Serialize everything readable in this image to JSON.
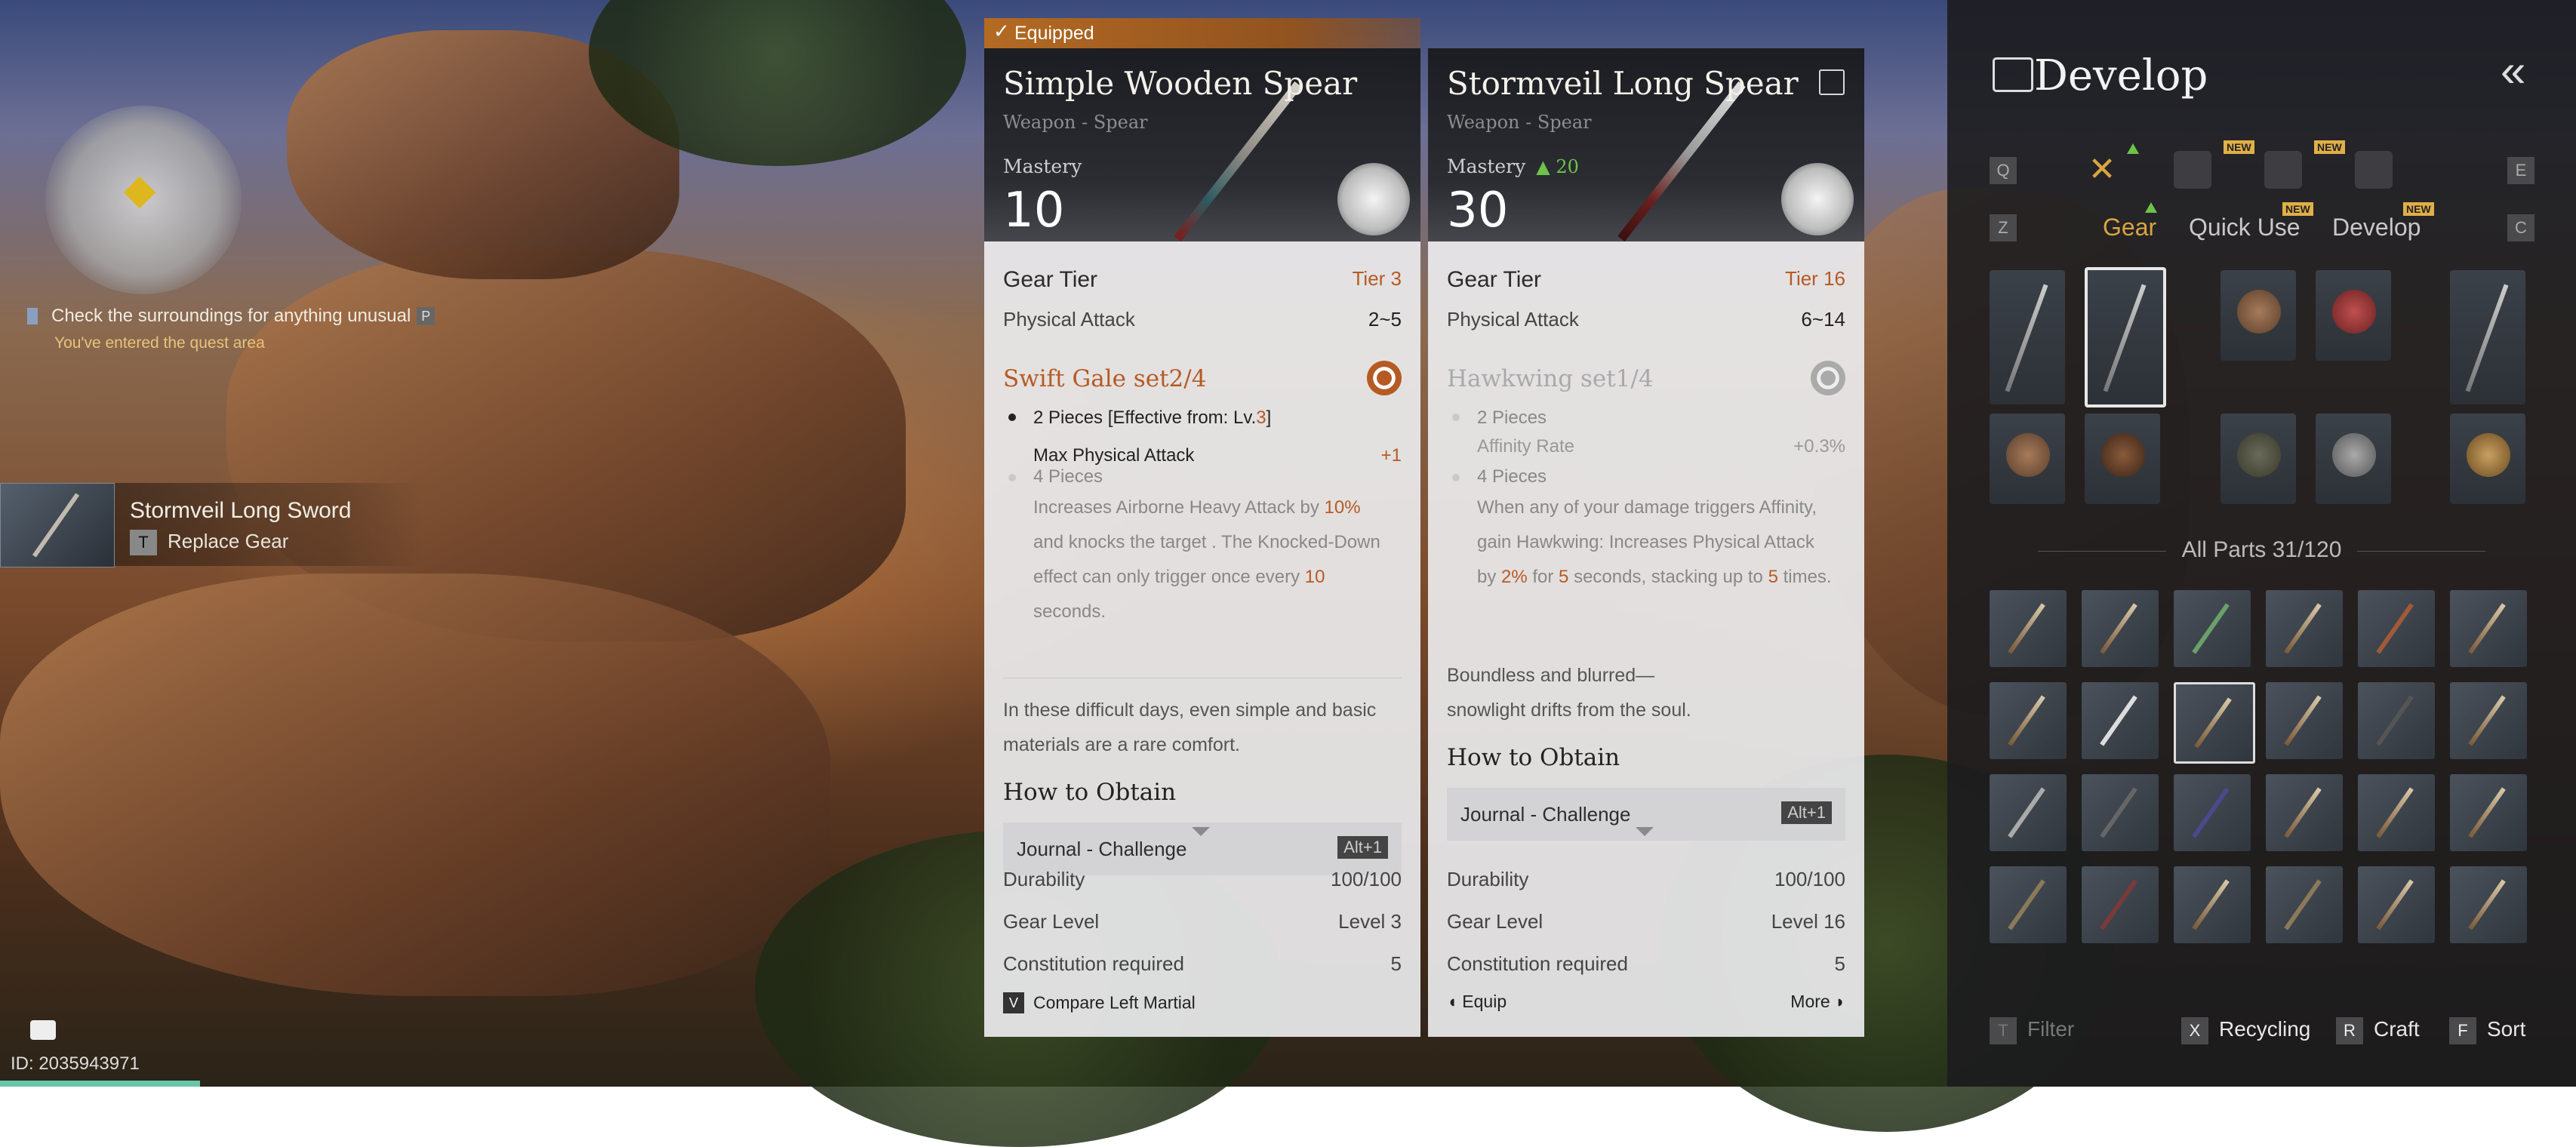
{
  "hud": {
    "quest_text": "Check the surroundings for anything unusual",
    "quest_key": "P",
    "quest_sub": "You've entered the quest area",
    "pickup_name": "Stormveil Long Sword",
    "pickup_key": "T",
    "pickup_action": "Replace Gear",
    "id_text": "ID: 2035943971"
  },
  "equipped_label": "Equipped",
  "left_card": {
    "name": "Simple Wooden Spear",
    "type": "Weapon - Spear",
    "mastery_label": "Mastery",
    "mastery": "10",
    "gear_tier_label": "Gear Tier",
    "gear_tier": "Tier 3",
    "phys_label": "Physical Attack",
    "phys": "2~5",
    "set_name": "Swift Gale set2/4",
    "piece2_label": "2 Pieces [Effective from: Lv.",
    "piece2_lv": "3",
    "piece2_close": "]",
    "piece2_stat": "Max Physical Attack",
    "piece2_val": "+1",
    "piece4_label": "4 Pieces",
    "piece4_text_a": "Increases Airborne Heavy Attack by ",
    "piece4_pct": "10%",
    "piece4_text_b": "and knocks the target . The Knocked-Down",
    "piece4_text_c": "effect can only trigger once every ",
    "piece4_num": "10",
    "piece4_text_d": "seconds.",
    "flavor_1": "In these difficult days, even simple and basic",
    "flavor_2": "materials are a rare comfort.",
    "obtain_title": "How to Obtain",
    "source": "Journal - Challenge",
    "source_key": "Alt+1",
    "durability_label": "Durability",
    "durability": "100/100",
    "gear_level_label": "Gear Level",
    "gear_level": "Level 3",
    "constitution_label": "Constitution required",
    "constitution": "5",
    "footer_key": "V",
    "footer_text": "Compare Left Martial"
  },
  "right_card": {
    "name": "Stormveil Long Spear",
    "type": "Weapon - Spear",
    "mastery_label": "Mastery",
    "mastery_delta": "20",
    "mastery": "30",
    "gear_tier_label": "Gear Tier",
    "gear_tier": "Tier 16",
    "phys_label": "Physical Attack",
    "phys": "6~14",
    "set_name": "Hawkwing set1/4",
    "piece2_label": "2 Pieces",
    "piece2_stat": "Affinity Rate",
    "piece2_val": "+0.3%",
    "piece4_label": "4 Pieces",
    "piece4_text_a": "When any of your damage triggers Affinity,",
    "piece4_text_b": "gain Hawkwing: Increases Physical Attack",
    "piece4_by": "by ",
    "piece4_pct": "2%",
    "piece4_for": " for ",
    "piece4_secs": "5",
    "piece4_stack": " seconds, stacking up to ",
    "piece4_times_n": "5",
    "piece4_times": " times.",
    "flavor_1": "Boundless and blurred—",
    "flavor_2": "snowlight drifts from the soul.",
    "obtain_title": "How to Obtain",
    "source": "Journal - Challenge",
    "source_key": "Alt+1",
    "durability_label": "Durability",
    "durability": "100/100",
    "gear_level_label": "Gear Level",
    "gear_level": "Level 16",
    "constitution_label": "Constitution required",
    "constitution": "5",
    "footer_left": "Equip",
    "footer_right": "More"
  },
  "panel": {
    "title": "Develop",
    "keys": {
      "q": "Q",
      "e": "E",
      "z": "Z",
      "c": "C"
    },
    "badge_new": "NEW",
    "tabs": [
      "Gear",
      "Quick Use",
      "Develop"
    ],
    "parts_header": "All Parts 31/120",
    "bottom": [
      {
        "key": "T",
        "label": "Filter"
      },
      {
        "key": "X",
        "label": "Recycling"
      },
      {
        "key": "R",
        "label": "Craft"
      },
      {
        "key": "F",
        "label": "Sort"
      }
    ]
  }
}
